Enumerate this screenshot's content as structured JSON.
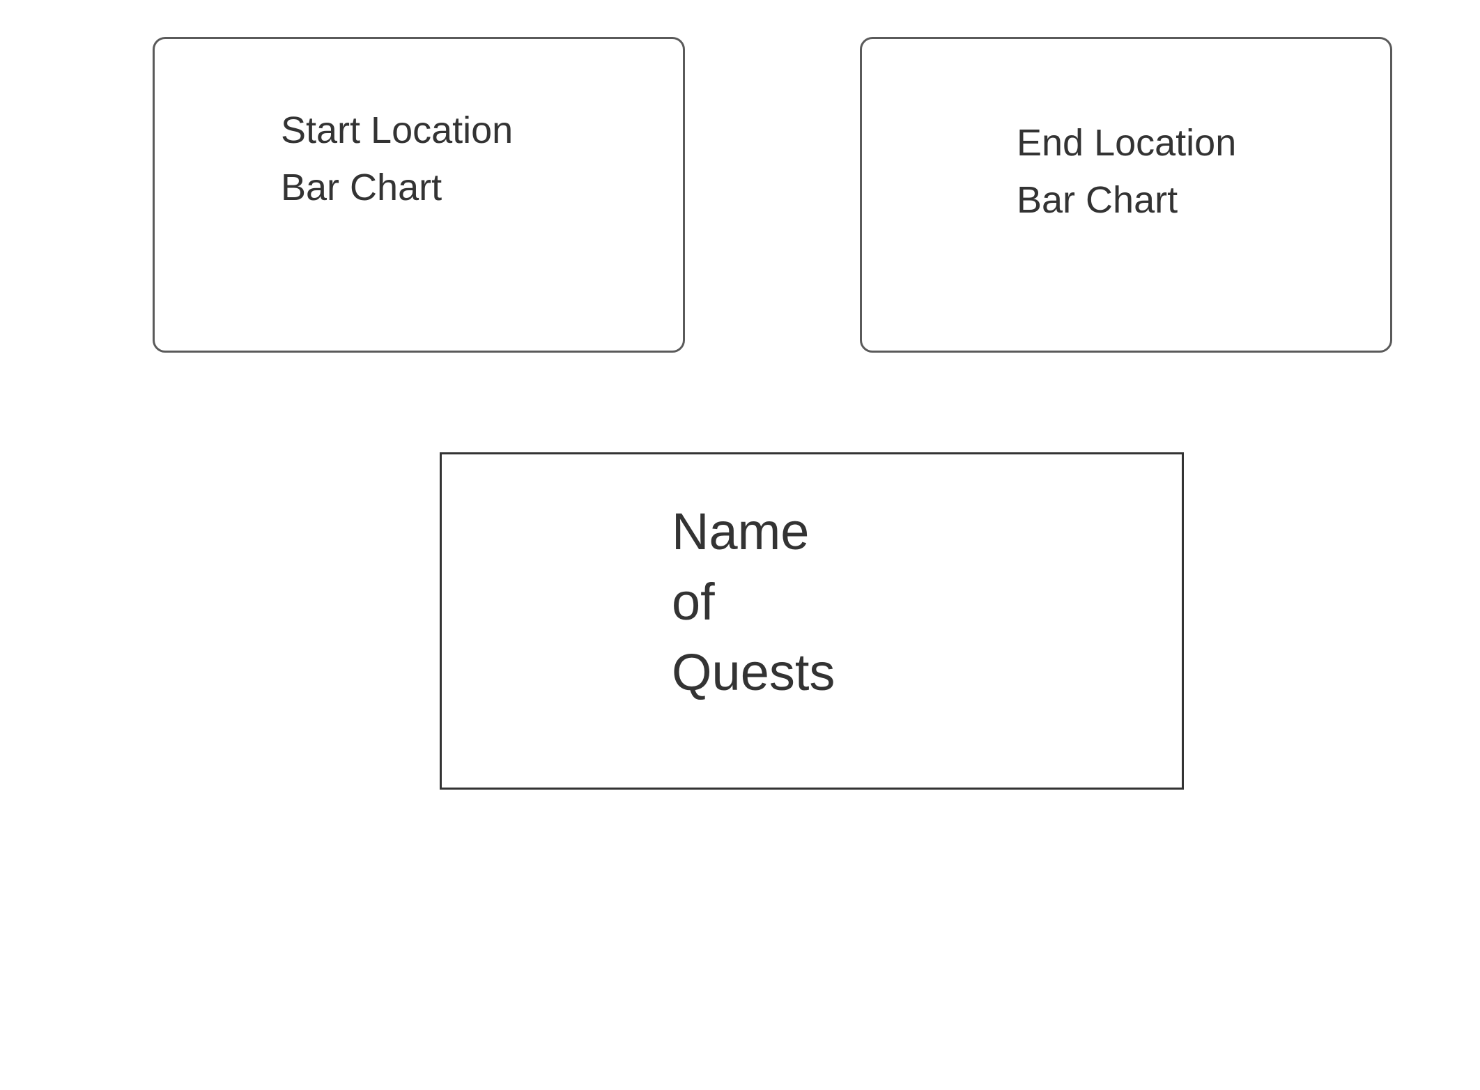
{
  "boxes": {
    "start_location": {
      "line1": "Start Location",
      "line2": "Bar Chart"
    },
    "end_location": {
      "line1": "End Location",
      "line2": "Bar Chart"
    },
    "quests": {
      "line1": "Name",
      "line2": "of",
      "line3": "Quests"
    }
  },
  "colors": {
    "border": "#5a5a5a",
    "text": "#333333",
    "background": "#ffffff"
  }
}
